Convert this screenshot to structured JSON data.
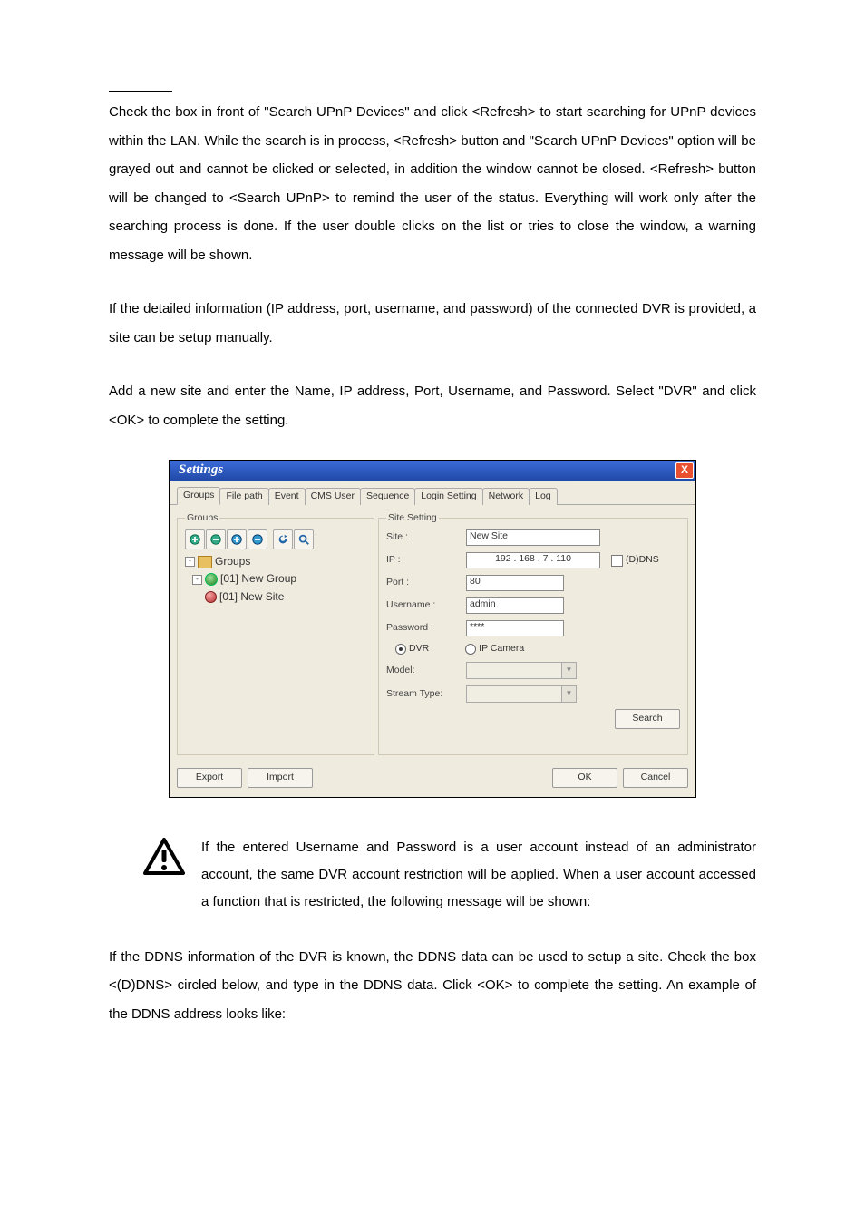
{
  "paragraphs": {
    "p1": "Check the box in front of \"Search UPnP Devices\" and click <Refresh> to start searching for UPnP devices within the LAN. While the search is in process, <Refresh> button and \"Search UPnP Devices\" option will be grayed out and cannot be clicked or selected, in addition the window cannot be closed. <Refresh> button will be changed to <Search UPnP> to remind the user of the status. Everything will work only after the searching process is done. If the user double clicks on the list or tries to close the window, a warning message will be shown.",
    "p2": "If the detailed information (IP address, port, username, and password) of the connected DVR is provided, a site can be setup manually.",
    "p3": "Add a new site and enter the Name, IP address, Port, Username, and Password. Select \"DVR\" and click <OK> to complete the setting.",
    "note": "If the entered Username and Password is a user account instead of an administrator account, the same DVR account restriction will be applied. When a user account accessed a function that is restricted, the following message will be shown:",
    "p4": "If the DDNS information of the DVR is known, the DDNS data can be used to setup a site. Check the box <(D)DNS> circled below, and type in the DDNS data. Click <OK> to complete the setting. An example of the DDNS address looks like:"
  },
  "settingsWindow": {
    "title": "Settings",
    "tabs": [
      "Groups",
      "File path",
      "Event",
      "CMS User",
      "Sequence",
      "Login Setting",
      "Network",
      "Log"
    ],
    "groupsPanel": {
      "legend": "Groups",
      "tree": {
        "root": "Groups",
        "group": "[01] New Group",
        "site": "[01] New Site"
      }
    },
    "siteSetting": {
      "legend": "Site Setting",
      "labels": {
        "site": "Site :",
        "ip": "IP :",
        "port": "Port :",
        "username": "Username :",
        "password": "Password :",
        "model": "Model:",
        "streamType": "Stream Type:"
      },
      "values": {
        "site": "New Site",
        "ip": "192 . 168 .  7  . 110",
        "port": "80",
        "username": "admin",
        "password": "****"
      },
      "ddnsLabel": "(D)DNS",
      "radios": {
        "dvr": "DVR",
        "ipcam": "IP Camera"
      },
      "buttons": {
        "search": "Search"
      }
    },
    "bottomButtons": {
      "export": "Export",
      "import": "Import",
      "ok": "OK",
      "cancel": "Cancel"
    }
  }
}
